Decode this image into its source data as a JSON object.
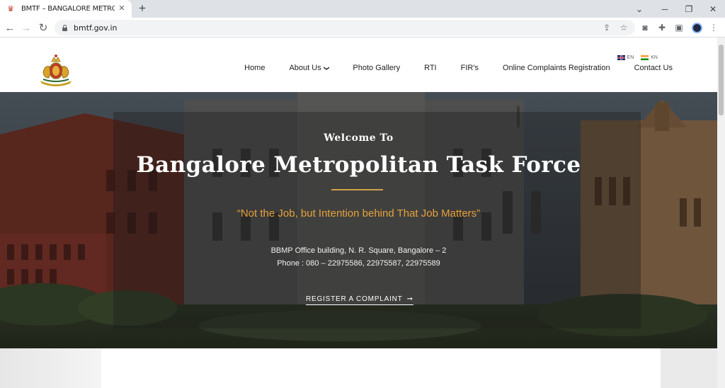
{
  "browser": {
    "tab_title": "BMTF – BANGALORE METROPOL",
    "url": "bmtf.gov.in"
  },
  "lang": {
    "en": "EN",
    "kn": "KN"
  },
  "nav": {
    "home": "Home",
    "about": "About Us",
    "gallery": "Photo Gallery",
    "rti": "RTI",
    "firs": "FIR's",
    "complaints": "Online Complaints Registration",
    "contact": "Contact Us"
  },
  "hero": {
    "welcome": "Welcome To",
    "title": "Bangalore Metropolitan Task Force",
    "tagline": "“Not the Job, but Intention behind That Job Matters”",
    "address": "BBMP Office building, N. R. Square, Bangalore – 2",
    "phone": "Phone : 080 – 22975586, 22975587, 22975589",
    "cta": "REGISTER A COMPLAINT"
  },
  "colors": {
    "accent_gold": "#d4a04a",
    "tagline_orange": "#e8a23a",
    "building_red": "#a13b2c"
  }
}
